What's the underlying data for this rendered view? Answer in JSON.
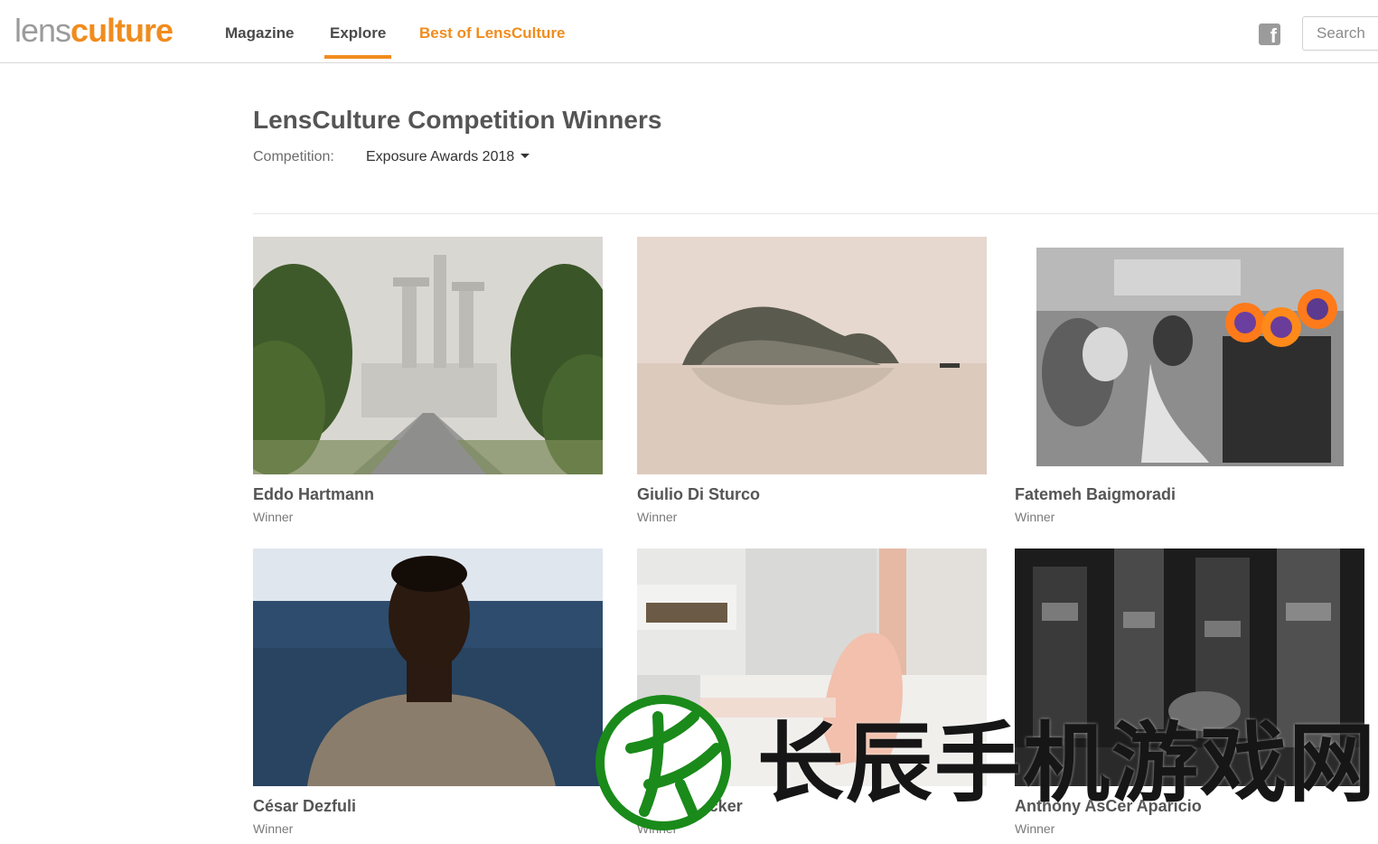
{
  "header": {
    "logo": {
      "part1": "lens",
      "part2": "culture"
    },
    "nav": [
      {
        "label": "Magazine"
      },
      {
        "label": "Explore"
      },
      {
        "label": "Best of LensCulture"
      }
    ],
    "social_icon": "facebook-icon",
    "search": {
      "placeholder": "Search",
      "value": ""
    }
  },
  "main": {
    "title": "LensCulture Competition Winners",
    "competition_label": "Competition:",
    "competition_value": "Exposure Awards 2018",
    "winners": [
      {
        "name": "Eddo Hartmann",
        "award": "Winner"
      },
      {
        "name": "Giulio Di Sturco",
        "award": "Winner"
      },
      {
        "name": "Fatemeh Baigmoradi",
        "award": "Winner"
      },
      {
        "name": "César Dezfuli",
        "award": "Winner"
      },
      {
        "name": "Nicole Tucker",
        "award": "Winner"
      },
      {
        "name": "Anthony AsCer Aparicio",
        "award": "Winner"
      }
    ]
  },
  "watermark": {
    "text": "长辰手机游戏网"
  },
  "colors": {
    "accent": "#f08c1e",
    "text": "#4a4a4a",
    "muted": "#9b9b9b",
    "watermark_green": "#1a8a1a"
  }
}
